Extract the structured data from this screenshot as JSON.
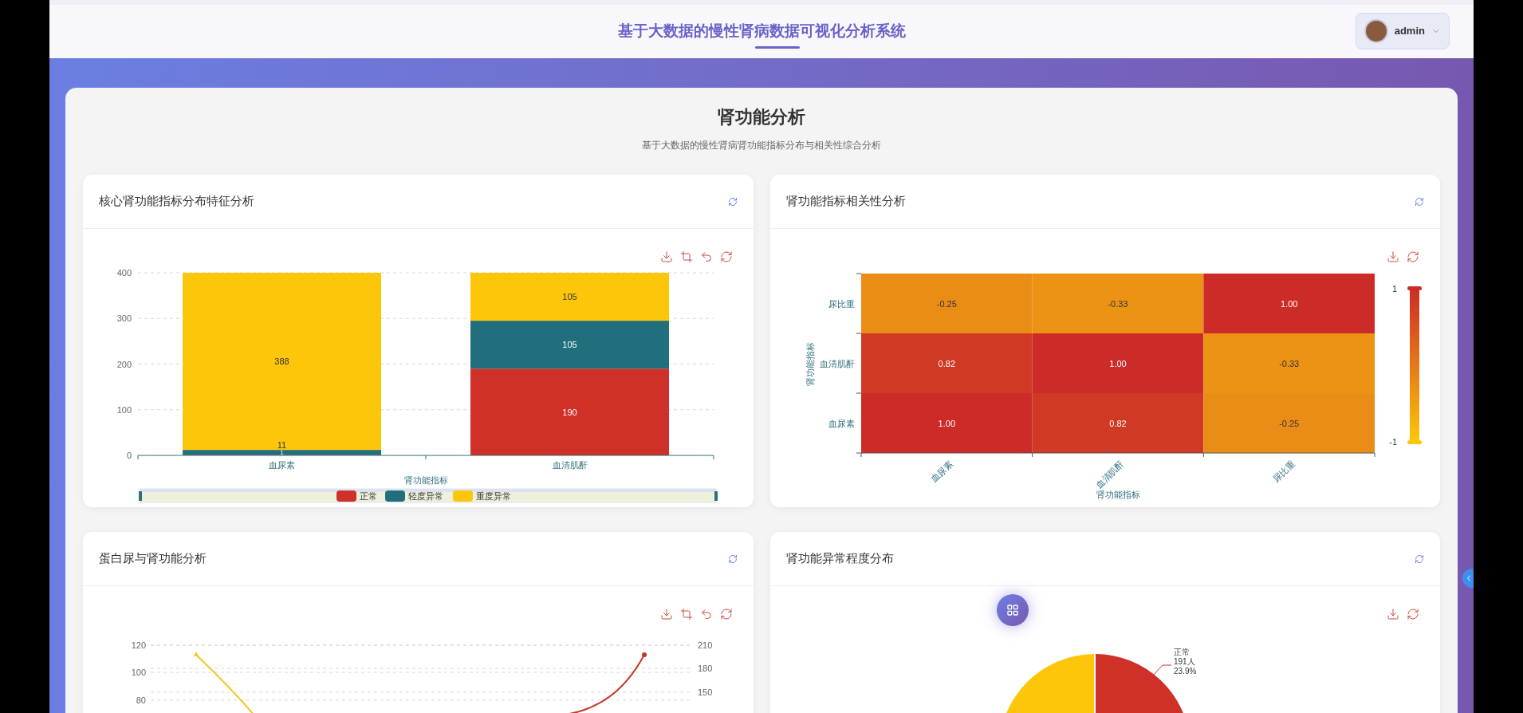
{
  "header": {
    "title": "基于大数据的慢性肾病数据可视化分析系统",
    "user": {
      "name": "admin"
    }
  },
  "page": {
    "title": "肾功能分析",
    "subtitle": "基于大数据的慢性肾病肾功能指标分布与相关性综合分析"
  },
  "panels": [
    {
      "kind": "chart",
      "title": "核心肾功能指标分布特征分析",
      "chart_data": {
        "type": "bar",
        "stacked": true,
        "grid": true,
        "legend": true,
        "xlabel": "肾功能指标",
        "categories": [
          "血尿素",
          "血清肌酐"
        ],
        "series": [
          {
            "name": "正常",
            "color": "#cf3027",
            "values": [
              1,
              190
            ]
          },
          {
            "name": "轻度异常",
            "color": "#216e7c",
            "values": [
              11,
              105
            ]
          },
          {
            "name": "重度异常",
            "color": "#fdc60b",
            "values": [
              388,
              105
            ]
          }
        ],
        "ylim": [
          0,
          400
        ],
        "yticks": [
          0,
          100,
          200,
          300,
          400
        ],
        "data_labels": true
      }
    },
    {
      "kind": "heatmap",
      "title": "肾功能指标相关性分析",
      "heatmap": {
        "xlabel": "肾功能指标",
        "ylabel": "肾功能指标",
        "x": [
          "血尿素",
          "血清肌酐",
          "尿比重"
        ],
        "y": [
          "尿比重",
          "血清肌酐",
          "血尿素"
        ],
        "cells": [
          [
            "-0.25",
            "-0.33",
            "1.00"
          ],
          [
            "0.82",
            "1.00",
            "-0.33"
          ],
          [
            "1.00",
            "0.82",
            "-0.25"
          ]
        ],
        "scale_max": "1",
        "scale_min": "-1"
      }
    },
    {
      "kind": "line",
      "title": "蛋白尿与肾功能分析",
      "left_ticks": [
        "120",
        "100",
        "80"
      ],
      "right_ticks": [
        "210",
        "180",
        "150"
      ]
    },
    {
      "kind": "pie",
      "title": "肾功能异常程度分布",
      "slice_label": [
        "正常",
        "191人",
        "23.9%"
      ]
    }
  ]
}
